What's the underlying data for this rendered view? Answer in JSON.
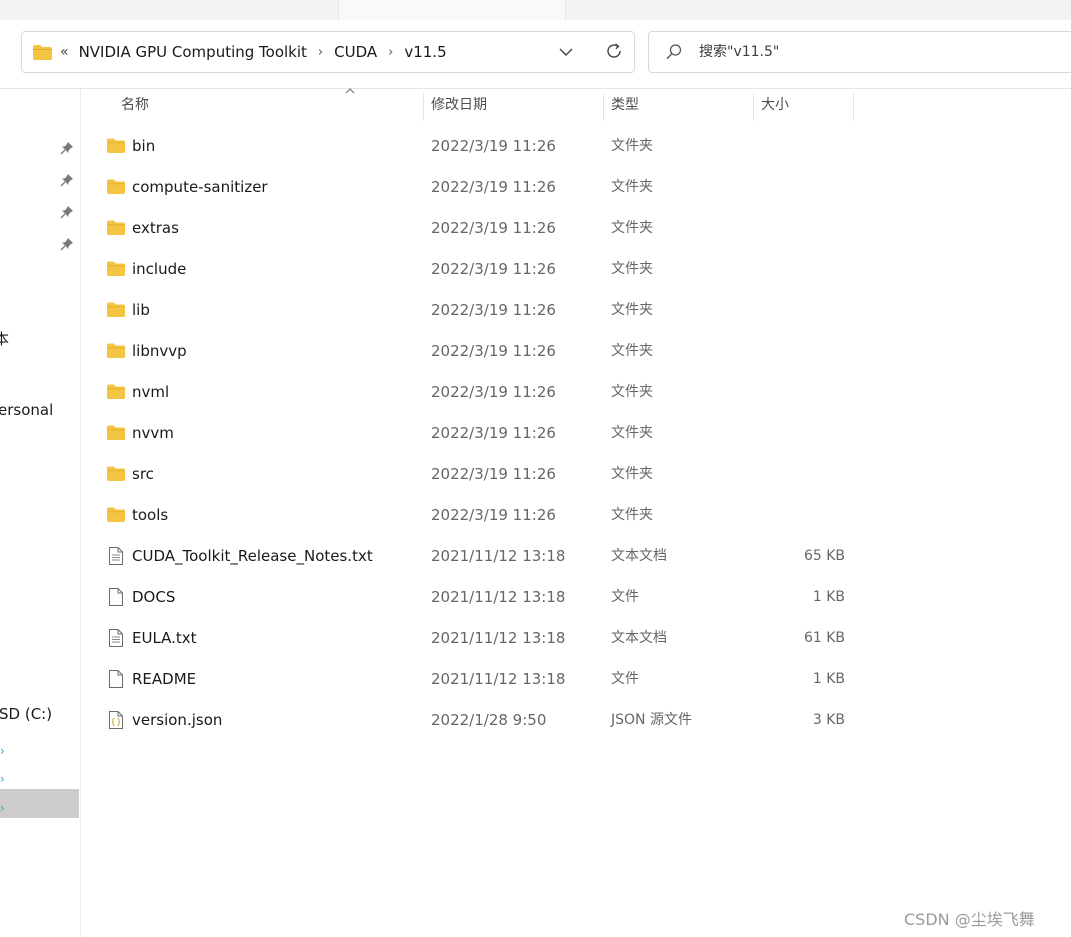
{
  "address": {
    "overflow": "«",
    "crumbs": [
      "NVIDIA GPU Computing Toolkit",
      "CUDA",
      "v11.5"
    ]
  },
  "search": {
    "placeholder": "搜索\"v11.5\""
  },
  "nav": {
    "fragments": [
      "本",
      "ersonal",
      "SD (C:)"
    ]
  },
  "columns": {
    "name": "名称",
    "date": "修改日期",
    "type": "类型",
    "size": "大小"
  },
  "files": [
    {
      "name": "bin",
      "date": "2022/3/19 11:26",
      "type": "文件夹",
      "size": "",
      "icon": "folder-icon"
    },
    {
      "name": "compute-sanitizer",
      "date": "2022/3/19 11:26",
      "type": "文件夹",
      "size": "",
      "icon": "folder-icon"
    },
    {
      "name": "extras",
      "date": "2022/3/19 11:26",
      "type": "文件夹",
      "size": "",
      "icon": "folder-icon"
    },
    {
      "name": "include",
      "date": "2022/3/19 11:26",
      "type": "文件夹",
      "size": "",
      "icon": "folder-icon"
    },
    {
      "name": "lib",
      "date": "2022/3/19 11:26",
      "type": "文件夹",
      "size": "",
      "icon": "folder-icon"
    },
    {
      "name": "libnvvp",
      "date": "2022/3/19 11:26",
      "type": "文件夹",
      "size": "",
      "icon": "folder-icon"
    },
    {
      "name": "nvml",
      "date": "2022/3/19 11:26",
      "type": "文件夹",
      "size": "",
      "icon": "folder-icon"
    },
    {
      "name": "nvvm",
      "date": "2022/3/19 11:26",
      "type": "文件夹",
      "size": "",
      "icon": "folder-icon"
    },
    {
      "name": "src",
      "date": "2022/3/19 11:26",
      "type": "文件夹",
      "size": "",
      "icon": "folder-icon"
    },
    {
      "name": "tools",
      "date": "2022/3/19 11:26",
      "type": "文件夹",
      "size": "",
      "icon": "folder-icon"
    },
    {
      "name": "CUDA_Toolkit_Release_Notes.txt",
      "date": "2021/11/12 13:18",
      "type": "文本文档",
      "size": "65 KB",
      "icon": "text-file-icon"
    },
    {
      "name": "DOCS",
      "date": "2021/11/12 13:18",
      "type": "文件",
      "size": "1 KB",
      "icon": "file-icon"
    },
    {
      "name": "EULA.txt",
      "date": "2021/11/12 13:18",
      "type": "文本文档",
      "size": "61 KB",
      "icon": "text-file-icon"
    },
    {
      "name": "README",
      "date": "2021/11/12 13:18",
      "type": "文件",
      "size": "1 KB",
      "icon": "file-icon"
    },
    {
      "name": "version.json",
      "date": "2022/1/28 9:50",
      "type": "JSON 源文件",
      "size": "3 KB",
      "icon": "json-file-icon"
    }
  ],
  "watermark": "CSDN @尘埃飞舞",
  "colors": {
    "folder": "#f4c443",
    "folderDark": "#e0a92a",
    "accent": "#3aa0d8"
  }
}
